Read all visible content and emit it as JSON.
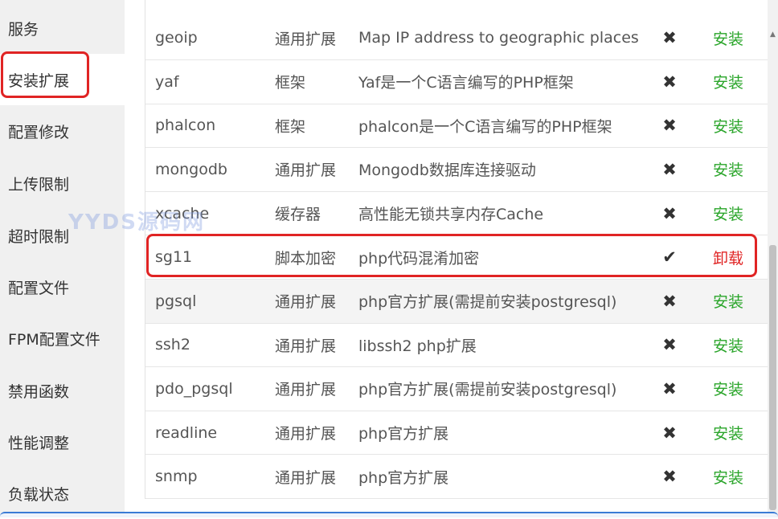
{
  "sidebar": {
    "items": [
      {
        "label": "服务"
      },
      {
        "label": "安装扩展"
      },
      {
        "label": "配置修改"
      },
      {
        "label": "上传限制"
      },
      {
        "label": "超时限制"
      },
      {
        "label": "配置文件"
      },
      {
        "label": "FPM配置文件"
      },
      {
        "label": "禁用函数"
      },
      {
        "label": "性能调整"
      },
      {
        "label": "负载状态"
      }
    ],
    "active_index": 1
  },
  "watermark": "YYDS源码网",
  "extensions": [
    {
      "name": "geoip",
      "type": "通用扩展",
      "desc": "Map IP address to geographic places",
      "state_icon": "✖",
      "installed": false,
      "op": "安装"
    },
    {
      "name": "yaf",
      "type": "框架",
      "desc": "Yaf是一个C语言编写的PHP框架",
      "state_icon": "✖",
      "installed": false,
      "op": "安装"
    },
    {
      "name": "phalcon",
      "type": "框架",
      "desc": "phalcon是一个C语言编写的PHP框架",
      "state_icon": "✖",
      "installed": false,
      "op": "安装"
    },
    {
      "name": "mongodb",
      "type": "通用扩展",
      "desc": "Mongodb数据库连接驱动",
      "state_icon": "✖",
      "installed": false,
      "op": "安装"
    },
    {
      "name": "xcache",
      "type": "缓存器",
      "desc": "高性能无锁共享内存Cache",
      "state_icon": "✖",
      "installed": false,
      "op": "安装"
    },
    {
      "name": "sg11",
      "type": "脚本加密",
      "desc": "php代码混淆加密",
      "state_icon": "✔",
      "installed": true,
      "op": "卸载"
    },
    {
      "name": "pgsql",
      "type": "通用扩展",
      "desc": "php官方扩展(需提前安装postgresql)",
      "state_icon": "✖",
      "installed": false,
      "op": "安装"
    },
    {
      "name": "ssh2",
      "type": "通用扩展",
      "desc": "libssh2 php扩展",
      "state_icon": "✖",
      "installed": false,
      "op": "安装"
    },
    {
      "name": "pdo_pgsql",
      "type": "通用扩展",
      "desc": "php官方扩展(需提前安装postgresql)",
      "state_icon": "✖",
      "installed": false,
      "op": "安装"
    },
    {
      "name": "readline",
      "type": "通用扩展",
      "desc": "php官方扩展",
      "state_icon": "✖",
      "installed": false,
      "op": "安装"
    },
    {
      "name": "snmp",
      "type": "通用扩展",
      "desc": "php官方扩展",
      "state_icon": "✖",
      "installed": false,
      "op": "安装"
    }
  ],
  "colors": {
    "install": "#2aa52a",
    "uninstall": "#e02424",
    "highlight": "#e02424"
  },
  "icons": {
    "state_not_installed": "x-icon",
    "state_installed": "check-icon",
    "scroll_up": "arrow-up-icon"
  }
}
